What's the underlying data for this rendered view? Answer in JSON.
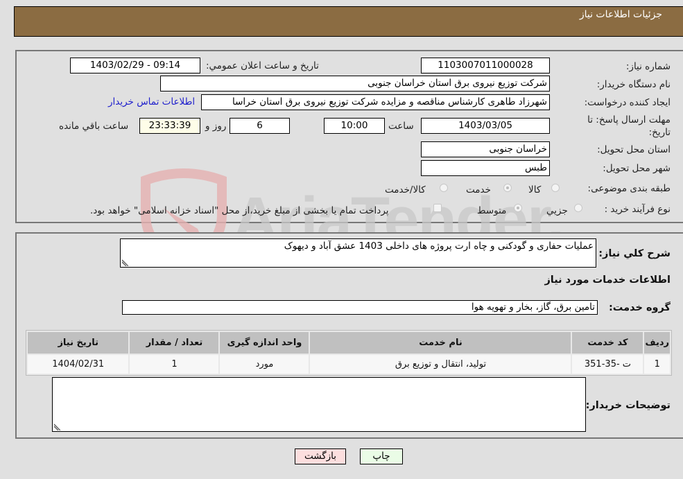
{
  "header": {
    "title": "جزئیات اطلاعات نیاز"
  },
  "form": {
    "need_number": {
      "label": "شماره نیاز:",
      "value": "1103007011000028"
    },
    "announce_datetime": {
      "label": "تاریخ و ساعت اعلان عمومي:",
      "value": "1403/02/29 - 09:14"
    },
    "buyer_org": {
      "label": "نام دستگاه خریدار:",
      "value": "شرکت توزیع نیروی برق استان خراسان جنوبی"
    },
    "requester": {
      "label": "ایجاد کننده درخواست:",
      "value": "شهرزاد طاهری کارشناس مناقصه و مزایده شرکت توزیع نیروی برق استان خراسا"
    },
    "buyer_contact_link": "اطلاعات تماس خریدار",
    "deadline": {
      "label": "مهلت ارسال پاسخ: تا تاریخ:",
      "date": "1403/03/05",
      "time_label": "ساعت",
      "time": "10:00",
      "days": "6",
      "days_label": "روز و",
      "remaining": "23:33:39",
      "remaining_label": "ساعت باقي مانده"
    },
    "province": {
      "label": "استان محل تحویل:",
      "value": "خراسان جنوبی"
    },
    "city": {
      "label": "شهر محل تحویل:",
      "value": "طبس"
    },
    "category": {
      "label": "طبقه بندی موضوعی:",
      "options": [
        "کالا",
        "خدمت",
        "کالا/خدمت"
      ],
      "selected": "خدمت"
    },
    "process_type": {
      "label": "نوع فرآیند خرید :",
      "options": [
        "جزيي",
        "متوسط"
      ],
      "selected": "متوسط",
      "treasury_checkbox_label": "پرداخت تمام یا بخشی از مبلغ خرید،از محل \"اسناد خزانه اسلامی\" خواهد بود.",
      "treasury_checked": false
    }
  },
  "details": {
    "summary_label": "شرح كلي نياز:",
    "summary_value": "عملیات حفاری و گودکنی و چاه ارت پروژه های داخلی 1403 عشق آباد و دیهوک",
    "services_heading": "اطلاعات خدمات مورد نياز",
    "service_group_label": "گروه خدمت:",
    "service_group_value": "تامین برق، گاز، بخار و تهویه هوا",
    "table": {
      "headers": [
        "ردیف",
        "کد خدمت",
        "نام خدمت",
        "واحد اندازه گیری",
        "تعداد / مقدار",
        "تاریخ نیاز"
      ],
      "rows": [
        [
          "1",
          "ت -35-351",
          "تولید، انتقال و توزیع برق",
          "مورد",
          "1",
          "1404/02/31"
        ]
      ]
    },
    "buyer_notes_label": "توضیحات خریدار:",
    "buyer_notes_value": ""
  },
  "buttons": {
    "print": "چاپ",
    "back": "بازگشت"
  },
  "watermark": {
    "text": "AriaTender.net"
  }
}
